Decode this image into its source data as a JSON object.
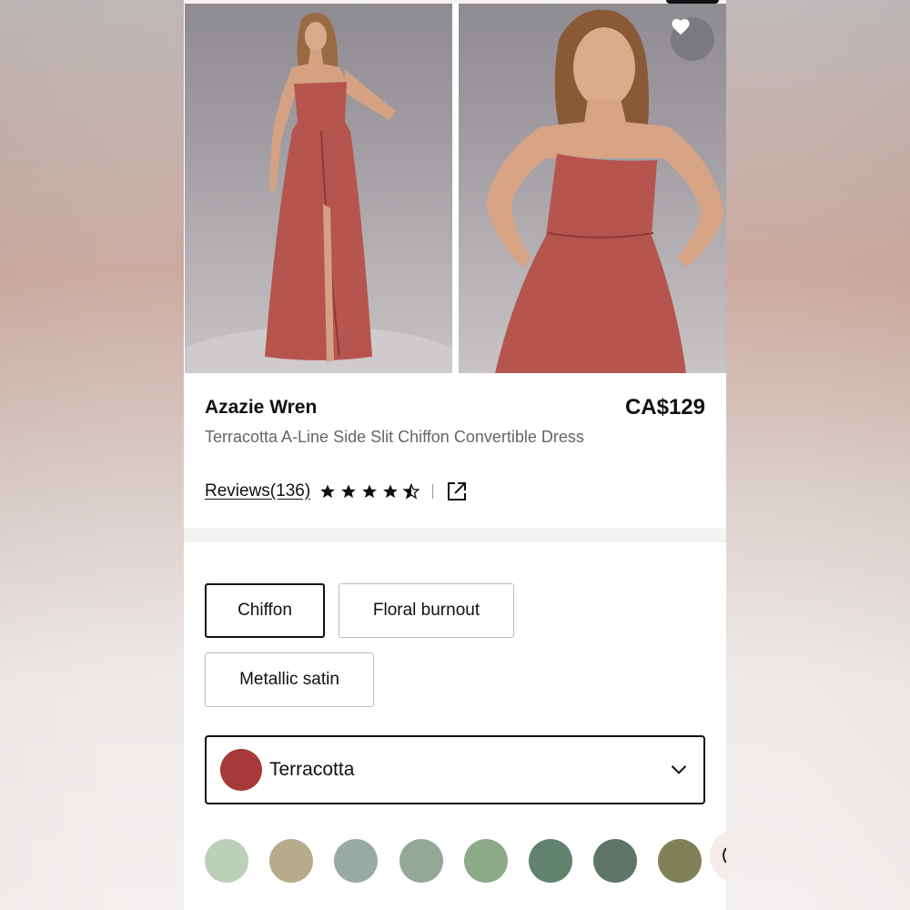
{
  "product": {
    "brand": "Azazie Wren",
    "price": "CA$129",
    "description": "Terracotta A-Line Side Slit Chiffon Convertible Dress",
    "reviews_label": "Reviews(136)",
    "rating": 4.5,
    "rating_max": 5
  },
  "fabrics": [
    {
      "label": "Chiffon",
      "selected": true
    },
    {
      "label": "Floral burnout",
      "selected": false
    },
    {
      "label": "Metallic satin",
      "selected": false
    }
  ],
  "color_select": {
    "selected_name": "Terracotta",
    "selected_color": "#a63a38"
  },
  "swatches": [
    "#bcd0b8",
    "#b7ab8b",
    "#98aaa6",
    "#94a898",
    "#8caa88",
    "#61826f",
    "#5e7667",
    "#7f8259"
  ],
  "icons": {
    "favorite": "heart-icon",
    "share": "external-link-icon",
    "dropdown": "chevron-down-icon",
    "star": "star-icon"
  },
  "colors": {
    "dress": "#b5554e",
    "background_photo": "#a09ca2"
  }
}
